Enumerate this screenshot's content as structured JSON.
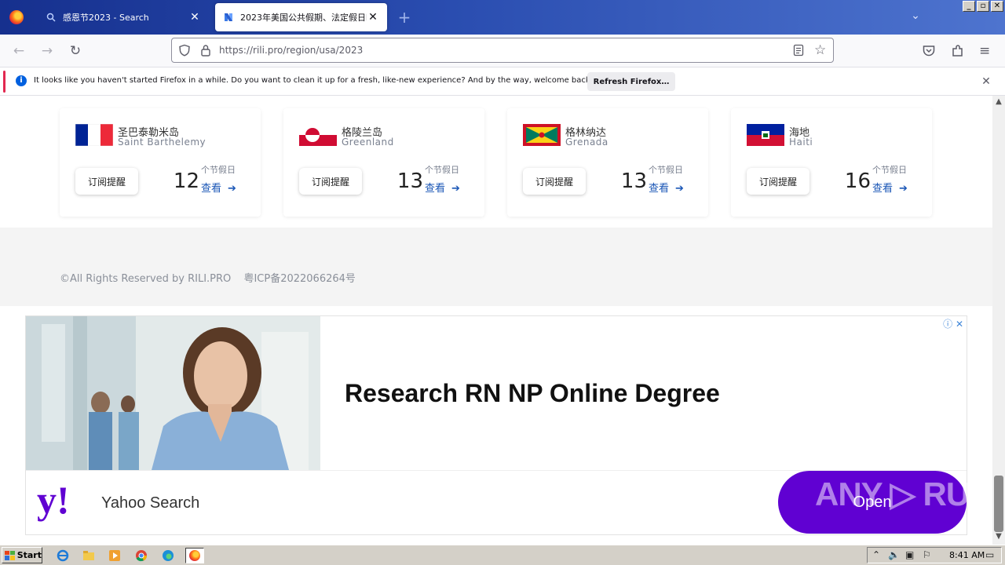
{
  "browser": {
    "tabs": [
      {
        "title": "感恩节2023 - Search",
        "icon": "search-icon"
      },
      {
        "title": "2023年美国公共假期、法定假日时间表",
        "icon": "rili-logo-icon"
      }
    ],
    "new_tab": "+",
    "url": "https://rili.pro/region/usa/2023"
  },
  "notification": {
    "message": "It looks like you haven't started Firefox in a while. Do you want to clean it up for a fresh, like-new experience? And by the way, welcome back!",
    "button": "Refresh Firefox…"
  },
  "cards": [
    {
      "name_zh": "圣巴泰勒米岛",
      "name_en": "Saint Barthelemy",
      "button": "订阅提醒",
      "count": "12",
      "unit": "个节假日",
      "view": "查看",
      "flag": "france"
    },
    {
      "name_zh": "格陵兰岛",
      "name_en": "Greenland",
      "button": "订阅提醒",
      "count": "13",
      "unit": "个节假日",
      "view": "查看",
      "flag": "greenland"
    },
    {
      "name_zh": "格林纳达",
      "name_en": "Grenada",
      "button": "订阅提醒",
      "count": "13",
      "unit": "个节假日",
      "view": "查看",
      "flag": "grenada"
    },
    {
      "name_zh": "海地",
      "name_en": "Haiti",
      "button": "订阅提醒",
      "count": "16",
      "unit": "个节假日",
      "view": "查看",
      "flag": "haiti"
    }
  ],
  "footer": {
    "copyright": "©All Rights Reserved by RILI.PRO",
    "icp": "粤ICP备2022066264号"
  },
  "ad": {
    "headline": "Research RN NP Online Degree",
    "advertiser": "Yahoo Search",
    "logo": "y!",
    "cta": "Open",
    "choices": "ⓘ ✕"
  },
  "watermark": "ANY ▷ RUN",
  "taskbar": {
    "start": "Start",
    "clock": "8:41 AM"
  }
}
